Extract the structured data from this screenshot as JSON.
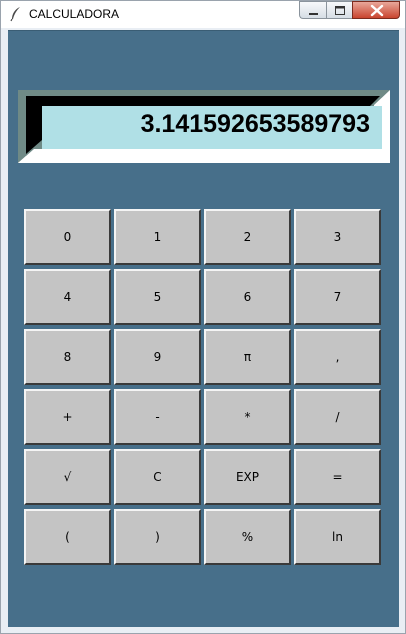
{
  "window": {
    "title": "CALCULADORA"
  },
  "display": {
    "value": "3.141592653589793"
  },
  "keypad": {
    "rows": [
      [
        "0",
        "1",
        "2",
        "3"
      ],
      [
        "4",
        "5",
        "6",
        "7"
      ],
      [
        "8",
        "9",
        "π",
        ","
      ],
      [
        "+",
        "-",
        "*",
        "/"
      ],
      [
        "√",
        "C",
        "EXP",
        "="
      ],
      [
        "(",
        ")",
        "%",
        "ln"
      ]
    ]
  },
  "colors": {
    "client_bg": "#476f8a",
    "display_bg": "#b0e0e6",
    "key_bg": "#c4c4c4"
  },
  "icons": {
    "app": "feather-icon",
    "minimize": "minimize-icon",
    "maximize": "maximize-icon",
    "close": "close-icon"
  }
}
